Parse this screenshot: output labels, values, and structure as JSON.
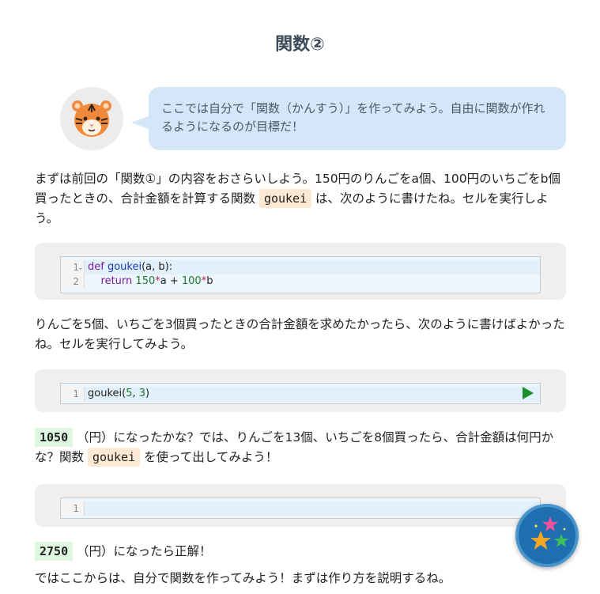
{
  "header": {
    "title": "関数②"
  },
  "speech": {
    "text": "ここでは自分で「関数（かんすう）」を作ってみよう。自由に関数が作れるようになるのが目標だ！"
  },
  "intro": {
    "before": "まずは前回の「関数①」の内容をおさらいしよう。150円のりんごをa個、100円のいちごをb個買ったときの、合計金額を計算する関数 ",
    "code": "goukei",
    "after": " は、次のように書けたね。セルを実行しよう。"
  },
  "cell1": {
    "line_numbers": [
      "1",
      "2"
    ],
    "line1": {
      "kw": "def",
      "fn": "goukei",
      "rest": "(a, b):"
    },
    "line2": {
      "indent": "    ",
      "kw": "return",
      "n1": "150",
      "op1": "*",
      "a": "a + ",
      "n2": "100",
      "op2": "*",
      "b": "b"
    }
  },
  "para2": {
    "text": "りんごを5個、いちごを3個買ったときの合計金額を求めたかったら、次のように書けばよかったね。セルを実行してみよう。"
  },
  "cell2": {
    "line_numbers": [
      "1"
    ],
    "fn": "goukei(",
    "n1": "5",
    "sep": ", ",
    "n2": "3",
    "close": ")"
  },
  "para3": {
    "result": "1050",
    "before": " （円）になったかな？では、りんごを13個、いちごを8個買ったら、合計金額は何円かな？関数 ",
    "code": "goukei",
    "after": " を使って出してみよう！"
  },
  "cell3": {
    "line_numbers": [
      "1"
    ],
    "value": ""
  },
  "para4": {
    "result": "2750",
    "text": " （円）になったら正解！"
  },
  "para5": {
    "text": "ではここからは、自分で関数を作ってみよう！まずは作り方を説明するね。"
  },
  "icons": {
    "avatar": "tiger-face-icon",
    "run": "play-icon",
    "fab": "stars-icon"
  },
  "colors": {
    "bubble": "#d4e6f8",
    "code_inline": "#fde8d3",
    "result_inline": "#dff6df",
    "run": "#1a8f2a",
    "fab": "#1f6fb0"
  }
}
